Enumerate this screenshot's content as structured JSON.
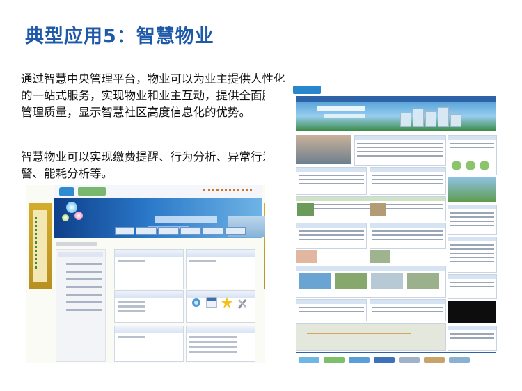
{
  "slide": {
    "title": "典型应用5：智慧物业",
    "paragraph1": "通过智慧中央管理平台，物业可以为业主提供人性化的一站式服务，实现物业和业主互动，提供全面服务管理质量，显示智慧社区高度信息化的优势。",
    "paragraph2": "智慧物业可以实现缴费提醒、行为分析、异常行为告警、能耗分析等。"
  },
  "colors": {
    "title": "#1f5aa8",
    "text": "#111111",
    "portal_blue": "#2d63a6",
    "banner_gold": "#c9a02a"
  },
  "icons": [
    "calendar-icon",
    "star-icon",
    "tools-icon",
    "globe-icon"
  ]
}
